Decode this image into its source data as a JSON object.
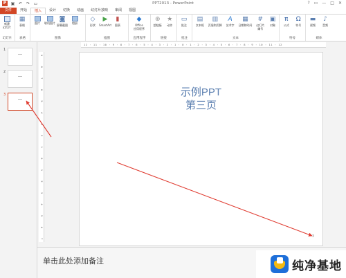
{
  "window": {
    "title": "PPT2013 - PowerPoint",
    "app_logo": "P",
    "quick_access": [
      "save-icon",
      "undo-icon",
      "redo-icon",
      "start-from-beginning-icon"
    ],
    "controls": [
      "?",
      "▭",
      "—",
      "□",
      "✕"
    ]
  },
  "tabs": [
    {
      "label": "文件",
      "kind": "file"
    },
    {
      "label": "开始"
    },
    {
      "label": "插入",
      "active": true
    },
    {
      "label": "设计"
    },
    {
      "label": "切换"
    },
    {
      "label": "动画"
    },
    {
      "label": "幻灯片放映"
    },
    {
      "label": "审阅"
    },
    {
      "label": "视图"
    }
  ],
  "ribbon": {
    "groups": [
      {
        "label": "幻灯片",
        "buttons": [
          {
            "label": "新建\n幻灯片",
            "icon": "new-slide-icon"
          }
        ]
      },
      {
        "label": "表格",
        "buttons": [
          {
            "label": "表格",
            "icon": "table-icon"
          }
        ]
      },
      {
        "label": "图像",
        "buttons": [
          {
            "label": "图片",
            "icon": "picture-icon"
          },
          {
            "label": "联机图片",
            "icon": "online-picture-icon"
          },
          {
            "label": "屏幕截图",
            "icon": "screenshot-icon"
          },
          {
            "label": "相册",
            "icon": "album-icon"
          }
        ]
      },
      {
        "label": "插图",
        "buttons": [
          {
            "label": "形状",
            "icon": "shapes-icon"
          },
          {
            "label": "SmartArt",
            "icon": "smartart-icon"
          },
          {
            "label": "图表",
            "icon": "chart-icon"
          }
        ]
      },
      {
        "label": "应用程序",
        "buttons": [
          {
            "label": "Office\n应用程序",
            "icon": "office-apps-icon"
          }
        ]
      },
      {
        "label": "链接",
        "buttons": [
          {
            "label": "超链接",
            "icon": "hyperlink-icon"
          },
          {
            "label": "动作",
            "icon": "action-icon"
          }
        ]
      },
      {
        "label": "批注",
        "buttons": [
          {
            "label": "批注",
            "icon": "comment-icon"
          }
        ]
      },
      {
        "label": "文本",
        "buttons": [
          {
            "label": "文本框",
            "icon": "textbox-icon"
          },
          {
            "label": "页眉和页脚",
            "icon": "header-footer-icon"
          },
          {
            "label": "艺术字",
            "icon": "wordart-icon"
          },
          {
            "label": "日期和时间",
            "icon": "date-time-icon"
          },
          {
            "label": "幻灯片\n编号",
            "icon": "slide-number-icon"
          },
          {
            "label": "对象",
            "icon": "object-icon"
          }
        ]
      },
      {
        "label": "符号",
        "buttons": [
          {
            "label": "公式",
            "icon": "equation-icon"
          },
          {
            "label": "符号",
            "icon": "symbol-icon"
          }
        ]
      },
      {
        "label": "媒体",
        "buttons": [
          {
            "label": "视频",
            "icon": "video-icon"
          },
          {
            "label": "音频",
            "icon": "audio-icon"
          }
        ]
      }
    ]
  },
  "thumbnails": [
    {
      "number": "1"
    },
    {
      "number": "2"
    },
    {
      "number": "3",
      "selected": true
    }
  ],
  "rulers": {
    "horizontal": "12 · 11 · 10 · 9 · 8 · 7 · 6 · 5 · 4 · 3 · 2 · 1 · 0 · 1 · 2 · 3 · 4 · 5 · 6 · 7 · 8 · 9 · 10 · 11 · 12",
    "vertical": "9 8 7 6 5 4 3 2 1 0 1 2 3 4 5 6 7 8 9"
  },
  "slide": {
    "title_line1": "示例PPT",
    "title_line2": "第三页",
    "page_number": "3"
  },
  "notes": {
    "placeholder": "单击此处添加备注"
  },
  "watermark": {
    "text": "纯净基地"
  },
  "colors": {
    "accent": "#d24726",
    "title_blue": "#5b7fb0",
    "arrow_red": "#e03c31"
  }
}
